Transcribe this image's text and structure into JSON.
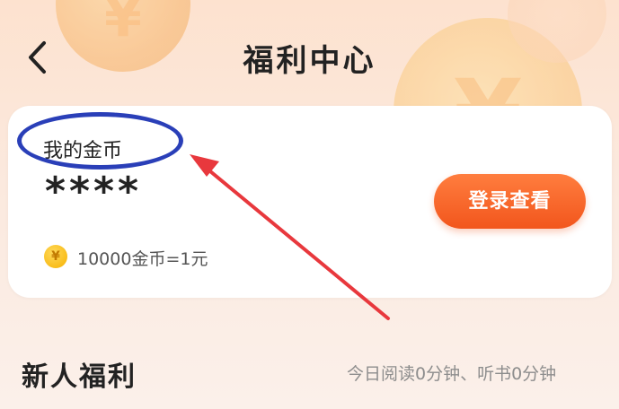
{
  "header": {
    "title": "福利中心",
    "back_icon": "chevron-left-icon"
  },
  "card": {
    "coins_label": "我的金币",
    "coins_value": "****",
    "login_button": "登录查看",
    "exchange_rate": "10000金币=1元",
    "coin_icon_glyph": "¥"
  },
  "section": {
    "title": "新人福利",
    "subtitle": "今日阅读0分钟、听书0分钟"
  },
  "colors": {
    "accent": "#f2561d",
    "annotation_ellipse": "#2a3fb8",
    "annotation_arrow": "#e8383d"
  }
}
